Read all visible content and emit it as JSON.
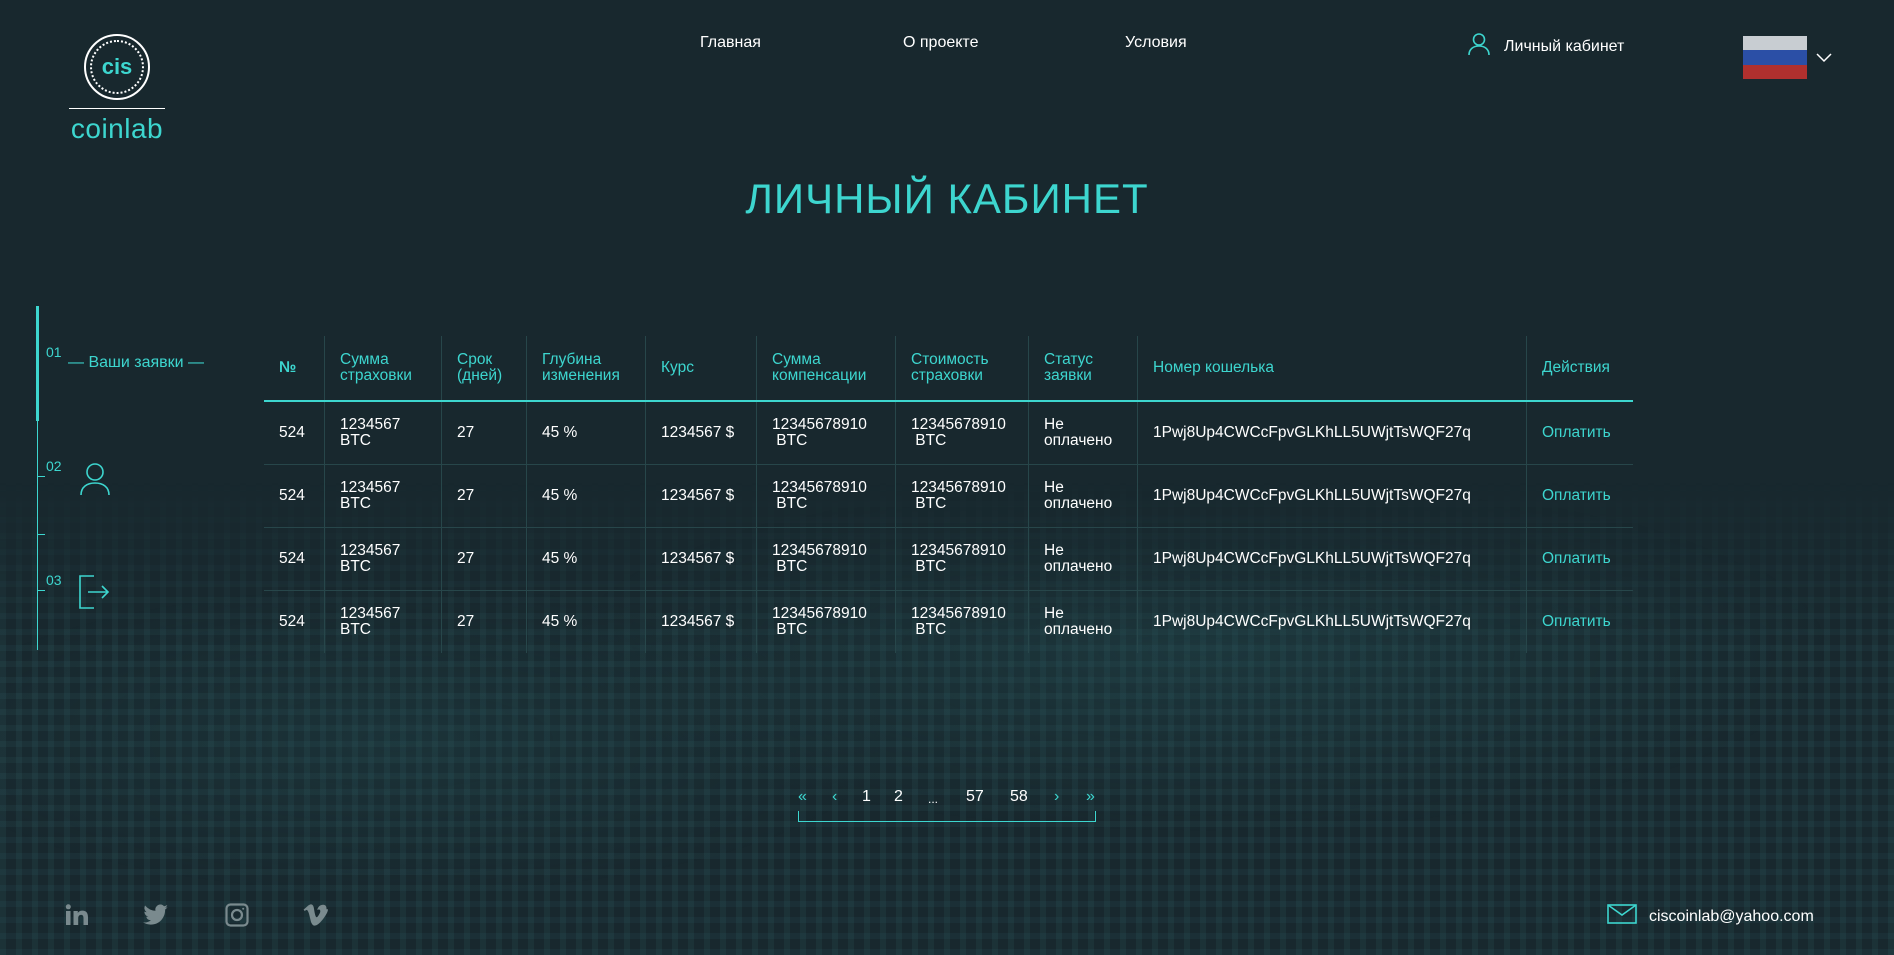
{
  "brand": {
    "abbr": "cis",
    "name": "coinlab"
  },
  "nav": {
    "items": [
      "Главная",
      "О проекте",
      "Условия"
    ],
    "account_label": "Личный кабинет"
  },
  "language": {
    "flag_colors": [
      "#c8cdd2",
      "#2b4fa6",
      "#b0302e"
    ]
  },
  "page_title": "ЛИЧНЫЙ КАБИНЕТ",
  "sidebar": {
    "items": [
      {
        "num": "01",
        "label": "— Ваши заявки —"
      },
      {
        "num": "02",
        "icon": "user-icon"
      },
      {
        "num": "03",
        "icon": "logout-icon"
      }
    ]
  },
  "table": {
    "headers": [
      [
        "№"
      ],
      [
        "Сумма",
        "страховки"
      ],
      [
        "Срок",
        "(дней)"
      ],
      [
        "Глубина",
        "изменения"
      ],
      [
        "Курс"
      ],
      [
        "Сумма",
        "компенсации"
      ],
      [
        "Стоимость",
        "страховки"
      ],
      [
        "Статус",
        "заявки"
      ],
      [
        "Номер кошелька"
      ],
      [
        "Действия"
      ]
    ],
    "rows": [
      {
        "num": "524",
        "sum": [
          "1234567",
          "BTC"
        ],
        "term": "27",
        "depth": "45 %",
        "rate": "1234567 $",
        "comp": [
          "12345678910",
          " BTC"
        ],
        "cost": [
          "12345678910",
          " BTC"
        ],
        "status": [
          "Не",
          "оплачено"
        ],
        "wallet": "1Pwj8Up4CWCcFpvGLKhLL5UWjtTsWQF27q",
        "action": "Оплатить"
      },
      {
        "num": "524",
        "sum": [
          "1234567",
          "BTC"
        ],
        "term": "27",
        "depth": "45 %",
        "rate": "1234567 $",
        "comp": [
          "12345678910",
          " BTC"
        ],
        "cost": [
          "12345678910",
          " BTC"
        ],
        "status": [
          "Не",
          "оплачено"
        ],
        "wallet": "1Pwj8Up4CWCcFpvGLKhLL5UWjtTsWQF27q",
        "action": "Оплатить"
      },
      {
        "num": "524",
        "sum": [
          "1234567",
          "BTC"
        ],
        "term": "27",
        "depth": "45 %",
        "rate": "1234567 $",
        "comp": [
          "12345678910",
          " BTC"
        ],
        "cost": [
          "12345678910",
          " BTC"
        ],
        "status": [
          "Не",
          "оплачено"
        ],
        "wallet": "1Pwj8Up4CWCcFpvGLKhLL5UWjtTsWQF27q",
        "action": "Оплатить"
      },
      {
        "num": "524",
        "sum": [
          "1234567",
          "BTC"
        ],
        "term": "27",
        "depth": "45 %",
        "rate": "1234567 $",
        "comp": [
          "12345678910",
          " BTC"
        ],
        "cost": [
          "12345678910",
          " BTC"
        ],
        "status": [
          "Не",
          "оплачено"
        ],
        "wallet": "1Pwj8Up4CWCcFpvGLKhLL5UWjtTsWQF27q",
        "action": "Оплатить"
      }
    ]
  },
  "pagination": {
    "first": "«",
    "prev": "‹",
    "pages": [
      "1",
      "2",
      "...",
      "57",
      "58"
    ],
    "next": "›",
    "last": "»"
  },
  "footer": {
    "social": [
      "linkedin-icon",
      "twitter-icon",
      "instagram-icon",
      "vimeo-icon"
    ],
    "email": "ciscoinlab@yahoo.com"
  },
  "colors": {
    "background": "#18282e",
    "accent": "#3dd6cf",
    "text": "#ffffff"
  }
}
